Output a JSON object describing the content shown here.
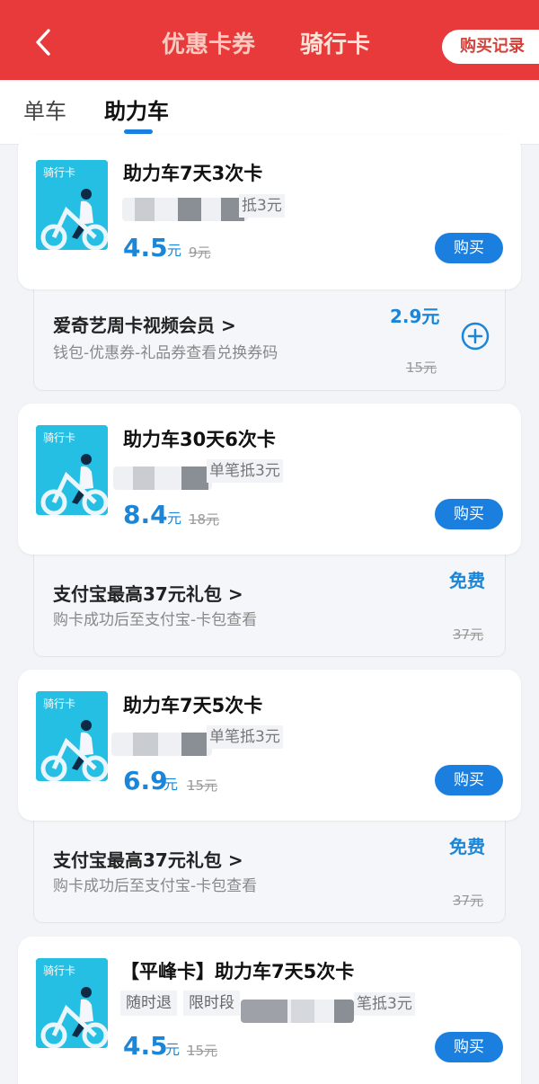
{
  "header": {
    "tab1": "优惠卡券",
    "tab2": "骑行卡",
    "record_button": "购买记录"
  },
  "subtabs": {
    "tab1": "单车",
    "tab2": "助力车"
  },
  "colors": {
    "header_red": "#e83a3a",
    "accent_blue": "#1b7fe0",
    "price_blue": "#1b86d8"
  },
  "cards": [
    {
      "thumb_label": "骑行卡",
      "title": "助力车7天3次卡",
      "deduct": "抵3元",
      "price": "4.5",
      "unit": "元",
      "original": "9元",
      "buy_label": "购买"
    },
    {
      "thumb_label": "骑行卡",
      "title": "助力车30天6次卡",
      "deduct": "单笔抵3元",
      "price": "8.4",
      "unit": "元",
      "original": "18元",
      "buy_label": "购买"
    },
    {
      "thumb_label": "骑行卡",
      "title": "助力车7天5次卡",
      "deduct": "单笔抵3元",
      "price": "6.9",
      "unit": "元",
      "original": "15元",
      "buy_label": "购买"
    },
    {
      "thumb_label": "骑行卡",
      "title": "【平峰卡】助力车7天5次卡",
      "chip1": "随时退",
      "chip2": "限时段",
      "deduct": "笔抵3元",
      "price": "4.5",
      "unit": "元",
      "original": "15元",
      "buy_label": "购买"
    }
  ],
  "promos": [
    {
      "title": "爱奇艺周卡视频会员",
      "subtitle": "钱包-优惠券-礼品券查看兑换券码",
      "price": "2.9元",
      "original": "15元"
    },
    {
      "title": "支付宝最高37元礼包",
      "subtitle": "购卡成功后至支付宝-卡包查看",
      "price": "免费",
      "original": "37元"
    },
    {
      "title": "支付宝最高37元礼包",
      "subtitle": "购卡成功后至支付宝-卡包查看",
      "price": "免费",
      "original": "37元"
    }
  ]
}
